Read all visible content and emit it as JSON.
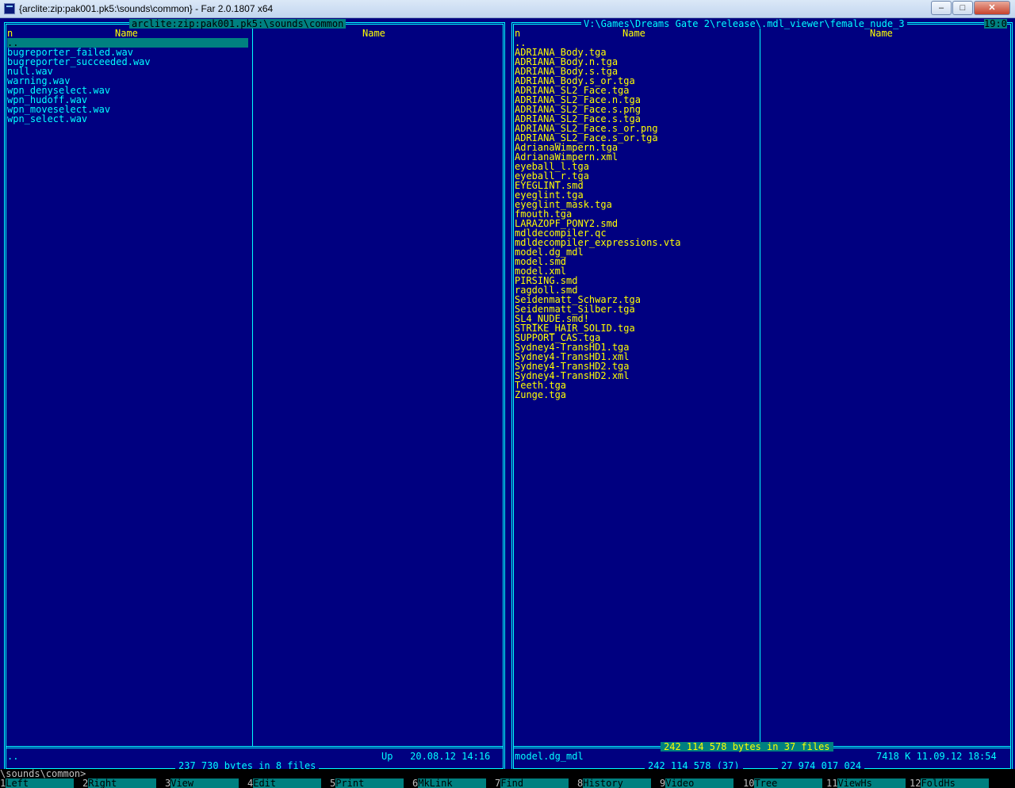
{
  "window": {
    "title": "{arclite:zip:pak001.pk5:\\sounds\\common} - Far 2.0.1807 x64",
    "buttons": {
      "minimize": "–",
      "maximize": "□",
      "close": "✕"
    }
  },
  "left_panel": {
    "path": "arclite:zip:pak001.pk5:\\sounds\\common",
    "col_n": "n",
    "col_name_1": "Name",
    "col_name_2": "Name",
    "files": [
      "..",
      "bugreporter_failed.wav",
      "bugreporter_succeeded.wav",
      "null.wav",
      "warning.wav",
      "wpn_denyselect.wav",
      "wpn_hudoff.wav",
      "wpn_moveselect.wav",
      "wpn_select.wav"
    ],
    "status_name": "..",
    "status_info": "Up   20.08.12 14:16",
    "summary": "237 730 bytes in 8 files"
  },
  "right_panel": {
    "path": "V:\\Games\\Dreams Gate 2\\release\\.mdl_viewer\\female_nude_3",
    "clock": "19:0",
    "col_n": "n",
    "col_name_1": "Name",
    "col_name_2": "Name",
    "files": [
      "..",
      "ADRIANA_Body.tga",
      "ADRIANA_Body.n.tga",
      "ADRIANA_Body.s.tga",
      "ADRIANA_Body.s_or.tga",
      "ADRIANA_SL2_Face.tga",
      "ADRIANA_SL2_Face.n.tga",
      "ADRIANA_SL2_Face.s.png",
      "ADRIANA_SL2_Face.s.tga",
      "ADRIANA_SL2_Face.s_or.png",
      "ADRIANA_SL2_Face.s_or.tga",
      "AdrianaWimpern.tga",
      "AdrianaWimpern.xml",
      "eyeball_l.tga",
      "eyeball_r.tga",
      "EYEGLINT.smd",
      "eyeglint.tga",
      "eyeglint_mask.tga",
      "fmouth.tga",
      "LARAZOPF_PONY2.smd",
      "mdldecompiler.qc",
      "mdldecompiler_expressions.vta",
      "model.dg_mdl",
      "model.smd",
      "model.xml",
      "PIRSING.smd",
      "ragdoll.smd",
      "Seidenmatt_Schwarz.tga",
      "Seidenmatt_Silber.tga",
      "SL4_NUDE.smd!",
      "STRIKE_HAIR_SOLID.tga",
      "SUPPORT_CAS.tga",
      "Sydney4-TransHD1.tga",
      "Sydney4-TransHD1.xml",
      "Sydney4-TransHD2.tga",
      "Sydney4-TransHD2.xml",
      "Teeth.tga",
      "Zunge.tga"
    ],
    "selection_info": "242 114 578 bytes in 37 files",
    "status_name": "model.dg_mdl",
    "status_info": "7418 K 11.09.12 18:54",
    "summary_1": "242 114 578 (37)",
    "summary_2": "27 974 017 024"
  },
  "command_line": "\\sounds\\common>_",
  "keybar": [
    {
      "num": "1",
      "label": "Left"
    },
    {
      "num": "2",
      "label": "Right"
    },
    {
      "num": "3",
      "label": "View"
    },
    {
      "num": "4",
      "label": "Edit"
    },
    {
      "num": "5",
      "label": "Print"
    },
    {
      "num": "6",
      "label": "MkLink"
    },
    {
      "num": "7",
      "label": "Find"
    },
    {
      "num": "8",
      "label": "History"
    },
    {
      "num": "9",
      "label": "Video"
    },
    {
      "num": "10",
      "label": "Tree"
    },
    {
      "num": "11",
      "label": "ViewHs"
    },
    {
      "num": "12",
      "label": "FoldHs"
    }
  ]
}
